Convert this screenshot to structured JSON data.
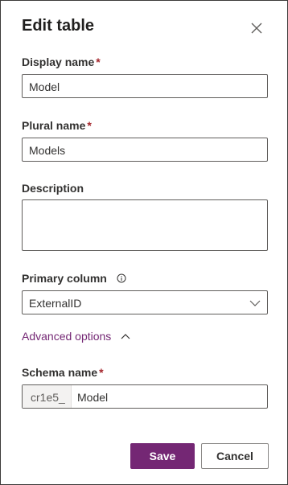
{
  "dialog": {
    "title": "Edit table",
    "close_icon": "close-icon"
  },
  "fields": {
    "display_name": {
      "label": "Display name",
      "required_mark": "*",
      "value": "Model"
    },
    "plural_name": {
      "label": "Plural name",
      "required_mark": "*",
      "value": "Models"
    },
    "description": {
      "label": "Description",
      "value": ""
    },
    "primary_column": {
      "label": "Primary column",
      "info_icon": "info-icon",
      "value": "ExternalID",
      "dropdown_icon": "chevron-down-icon"
    },
    "advanced": {
      "label": "Advanced options",
      "toggle_icon": "chevron-up-icon"
    },
    "schema_name": {
      "label": "Schema name",
      "required_mark": "*",
      "prefix": "cr1e5_",
      "value": "Model"
    }
  },
  "actions": {
    "save_label": "Save",
    "cancel_label": "Cancel"
  },
  "colors": {
    "accent": "#742774",
    "required": "#a4262c",
    "border": "#605e5c"
  }
}
